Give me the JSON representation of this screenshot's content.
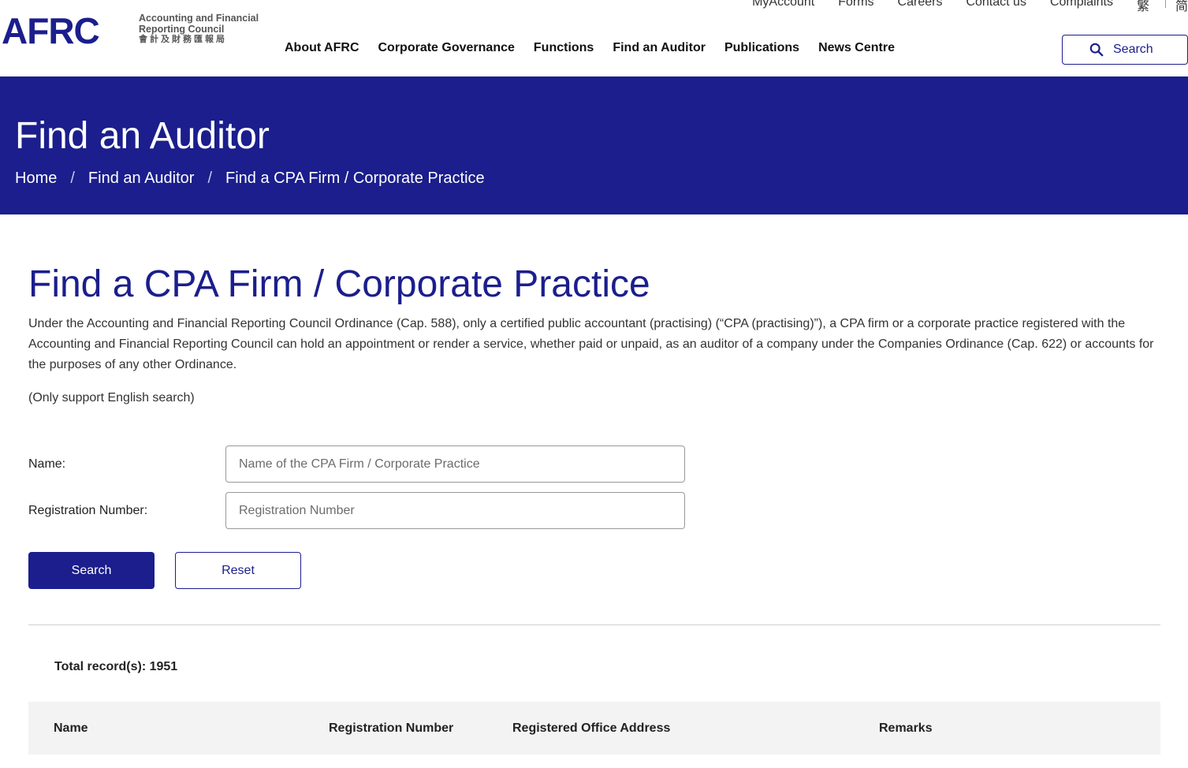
{
  "header": {
    "logo_mark": "AFRC",
    "logo_line1": "Accounting and Financial",
    "logo_line2": "Reporting Council",
    "logo_zh": "會計及財務匯報局",
    "util_links": [
      "MyAccount",
      "Forms",
      "Careers",
      "Contact us",
      "Complaints"
    ],
    "lang_tc": "繁",
    "lang_sc": "简",
    "nav": [
      "About AFRC",
      "Corporate Governance",
      "Functions",
      "Find an Auditor",
      "Publications",
      "News Centre"
    ],
    "search_label": "Search"
  },
  "banner": {
    "title": "Find an Auditor",
    "breadcrumb": [
      "Home",
      "Find an Auditor",
      "Find a CPA Firm / Corporate Practice"
    ],
    "separator": "/"
  },
  "main": {
    "title": "Find a CPA Firm / Corporate Practice",
    "intro": "Under the Accounting and Financial Reporting Council Ordinance (Cap. 588), only a certified public accountant (practising) (“CPA (practising)”), a CPA firm or a corporate practice registered with the Accounting and Financial Reporting Council can hold an appointment or render a service, whether paid or unpaid, as an auditor of a company under the Companies Ordinance (Cap. 622) or accounts for the purposes of any other Ordinance.",
    "note": "(Only support English search)",
    "form": {
      "name_label": "Name:",
      "name_placeholder": "Name of the CPA Firm / Corporate Practice",
      "name_value": "",
      "reg_label": "Registration Number:",
      "reg_placeholder": "Registration Number",
      "reg_value": "",
      "search_button": "Search",
      "reset_button": "Reset"
    },
    "total_records": "Total record(s): 1951",
    "table_headers": [
      "Name",
      "Registration Number",
      "Registered Office Address",
      "Remarks"
    ]
  },
  "colors": {
    "brand_navy": "#1b1e8c",
    "table_header_bg": "#f3f3f3"
  }
}
